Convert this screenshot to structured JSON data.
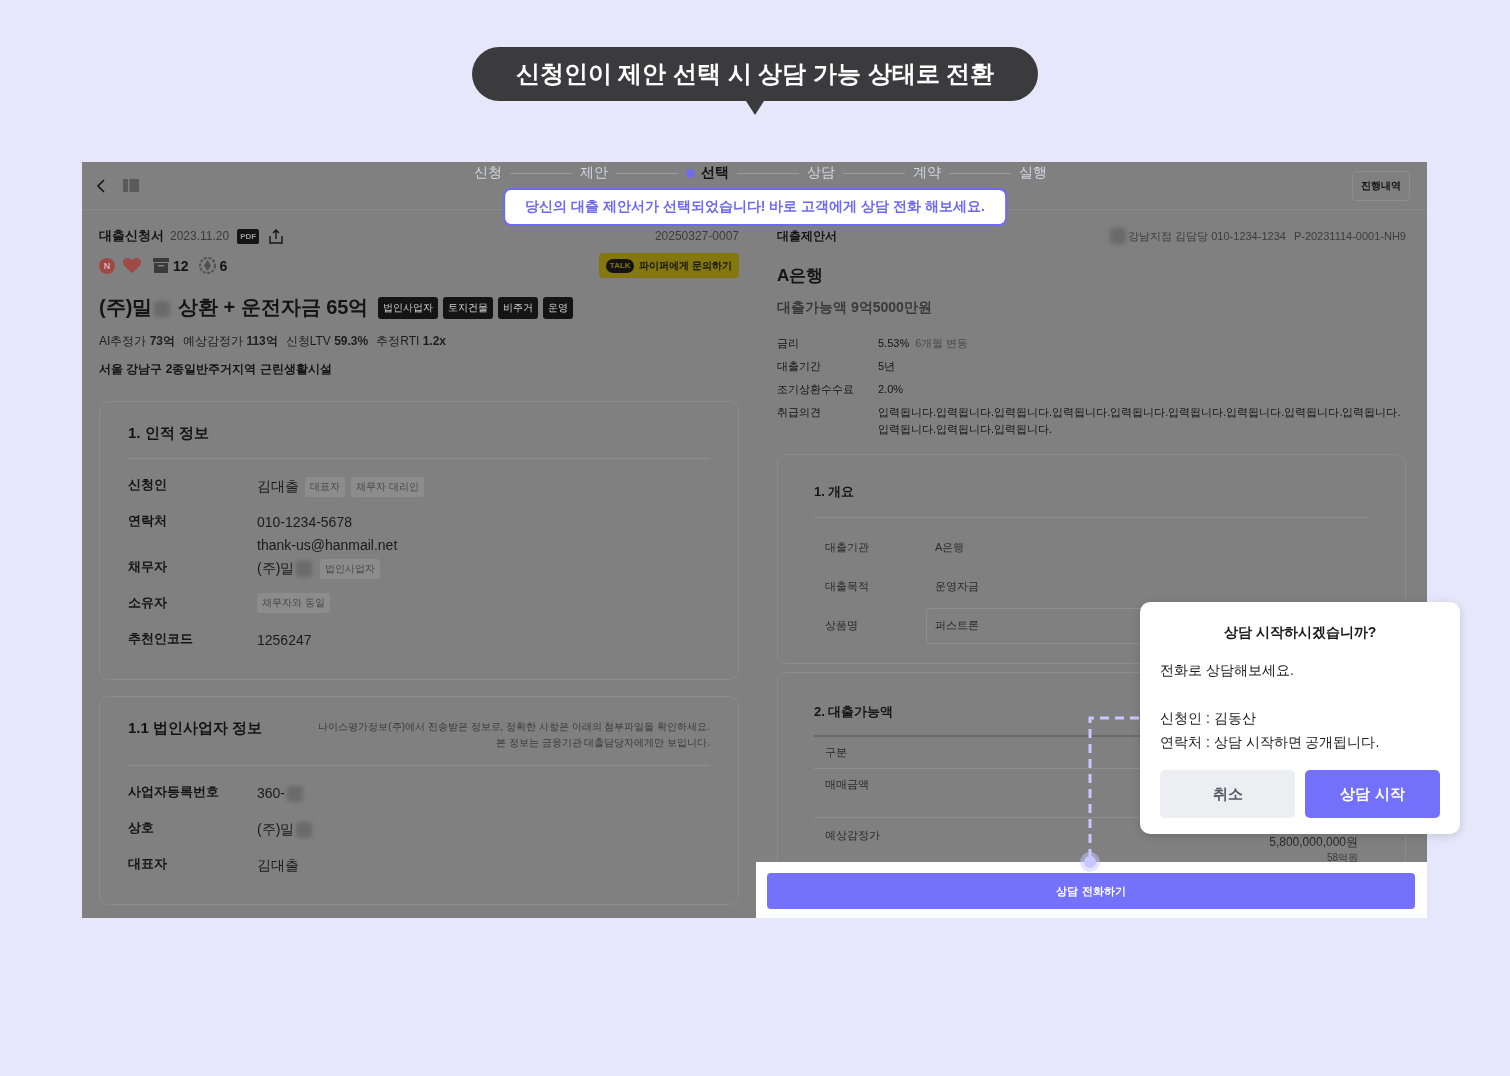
{
  "callout": {
    "text": "신청인이 제안 선택 시 상담 가능 상태로 전환"
  },
  "steps": [
    {
      "label": "신청",
      "selected": false
    },
    {
      "label": "제안",
      "selected": false
    },
    {
      "label": "선택",
      "selected": true
    },
    {
      "label": "상담",
      "selected": false
    },
    {
      "label": "계약",
      "selected": false
    },
    {
      "label": "실행",
      "selected": false
    }
  ],
  "toast": {
    "text": "당신의 대출 제안서가 선택되었습니다! 바로 고객에게 상담 전화 해보세요."
  },
  "history_button": "진행내역",
  "application": {
    "title": "대출신청서",
    "date": "2023.11.20",
    "pdf_label": "PDF",
    "number": "20250327-0007",
    "n_badge": "N",
    "counters": [
      {
        "kind": "archive",
        "value": "12"
      },
      {
        "kind": "badge",
        "value": "6"
      }
    ],
    "contact_button": {
      "label": "파이퍼에게 문의하기",
      "icon_text": "TALK"
    },
    "heading": {
      "text": "(주)밀",
      "redacted": true,
      "rest": "상환 + 운전자금 65억"
    },
    "tags": [
      "법인사업자",
      "토지건물",
      "비주거",
      "운영"
    ],
    "stats": [
      "AI추정가 **73억**",
      "예상감정가 **113억**",
      "신청LTV **59.3%**",
      "추정RTI **1.2x**"
    ],
    "address": "서울 강남구 2종일반주거지역 근린생활시설",
    "sections": [
      {
        "title": "1. 인적 정보",
        "rows": [
          {
            "label": "신청인",
            "lines": [
              "김대출"
            ],
            "chips": [
              "대표자",
              "채무자 대리인"
            ],
            "redacted": false
          },
          {
            "label": "연락처",
            "lines": [
              "010-1234-5678",
              "thank-us@hanmail.net"
            ],
            "redacted": false
          },
          {
            "label": "채무자",
            "lines": [
              "(주)밀"
            ],
            "chips": [
              "법인사업자"
            ],
            "redacted": true
          },
          {
            "label": "소유자",
            "chips": [
              "채무자와 동일"
            ],
            "redacted": false
          },
          {
            "label": "추천인코드",
            "lines": [
              "1256247"
            ],
            "redacted": false
          }
        ]
      },
      {
        "title": "1.1 법인사업자 정보",
        "note": [
          "나이스평가정보(주)에서 전송받은 정보로, 정확한 사항은 아래의 첨부파일을 확인하세요.",
          "본 정보는 금융기관 대출담당자에게만 보입니다."
        ],
        "rows": [
          {
            "label": "사업자등록번호",
            "lines": [
              "360-"
            ],
            "redacted": true
          },
          {
            "label": "상호",
            "lines": [
              "(주)밀"
            ],
            "redacted": true
          },
          {
            "label": "대표자",
            "lines": [
              "김대출"
            ],
            "redacted": false
          }
        ]
      }
    ]
  },
  "proposal": {
    "title": "대출제안서",
    "branch": "강남지점 김담당 010-1234-1234",
    "branch_redacted": true,
    "code": "P-20231114-0001-NH9",
    "bank": "A은행",
    "amount": "대출가능액 9억5000만원",
    "terms": [
      {
        "label": "금리",
        "value": "5.53%",
        "note": "6개월 변동"
      },
      {
        "label": "대출기간",
        "value": "5년"
      },
      {
        "label": "조기상환수수료",
        "value": "2.0%"
      },
      {
        "label": "취급의견",
        "value": "입력됩니다.입력됩니다.입력됩니다.입력됩니다.입력됩니다.입력됩니다.입력됩니다.입력됩니다.입력됩니다.입력됩니다.입력됩니다.입력됩니다."
      }
    ],
    "overview": {
      "title": "1. 개요",
      "rows": [
        {
          "label": "대출기관",
          "value": "A은행",
          "kind": "text"
        },
        {
          "label": "대출목적",
          "value": "운영자금",
          "kind": "text"
        },
        {
          "label": "상품명",
          "value": "퍼스트론",
          "kind": "field"
        }
      ]
    },
    "amounts": {
      "title": "2. 대출가능액",
      "rows": [
        {
          "label": "구분"
        },
        {
          "label": "매매금액"
        },
        {
          "label": "예상감정가",
          "value": "5,800,000,000원",
          "sub": "58억원"
        }
      ]
    },
    "call_button": "상담 전화하기"
  },
  "dialog": {
    "title": "상담 시작하시겠습니까?",
    "message": "전화로 상담해보세요.",
    "details": [
      "신청인 : 김동산",
      "연락처 : 상담 시작하면 공개됩니다."
    ],
    "buttons": [
      {
        "label": "취소",
        "kind": "secondary"
      },
      {
        "label": "상담 시작",
        "kind": "primary"
      }
    ]
  }
}
